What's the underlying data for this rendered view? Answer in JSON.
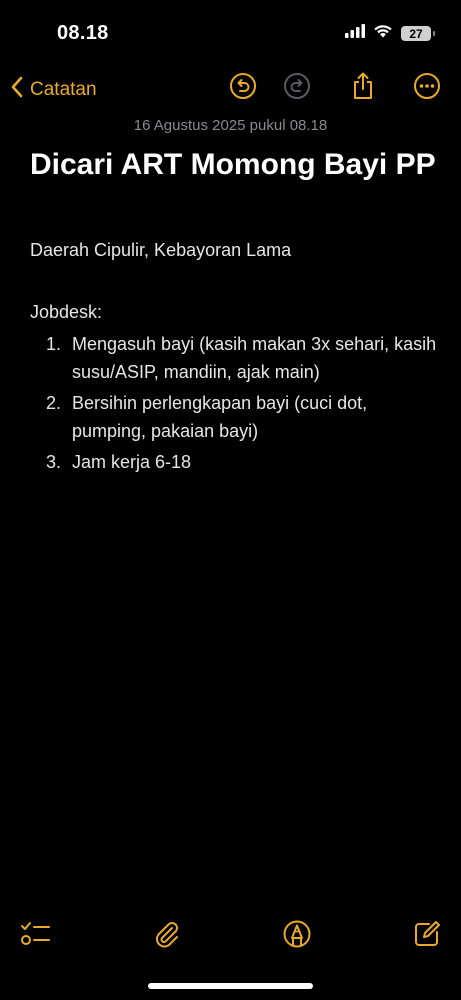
{
  "status_bar": {
    "time": "08.18",
    "battery": "27"
  },
  "nav": {
    "back_label": "Catatan"
  },
  "note": {
    "date": "16 Agustus 2025 pukul 08.18",
    "title": "Dicari ART Momong Bayi PP",
    "location": "Daerah Cipulir, Kebayoran Lama",
    "section_label": "Jobdesk:",
    "items": [
      {
        "num": "1.",
        "text": "Mengasuh bayi (kasih makan 3x sehari, kasih susu/ASIP, mandiin, ajak main)"
      },
      {
        "num": "2.",
        "text": "Bersihin perlengkapan bayi (cuci dot, pumping, pakaian bayi)"
      },
      {
        "num": "3.",
        "text": "Jam kerja 6-18"
      }
    ]
  },
  "colors": {
    "accent": "#e8aa28",
    "background": "#000000",
    "muted": "#8a8a8e"
  }
}
